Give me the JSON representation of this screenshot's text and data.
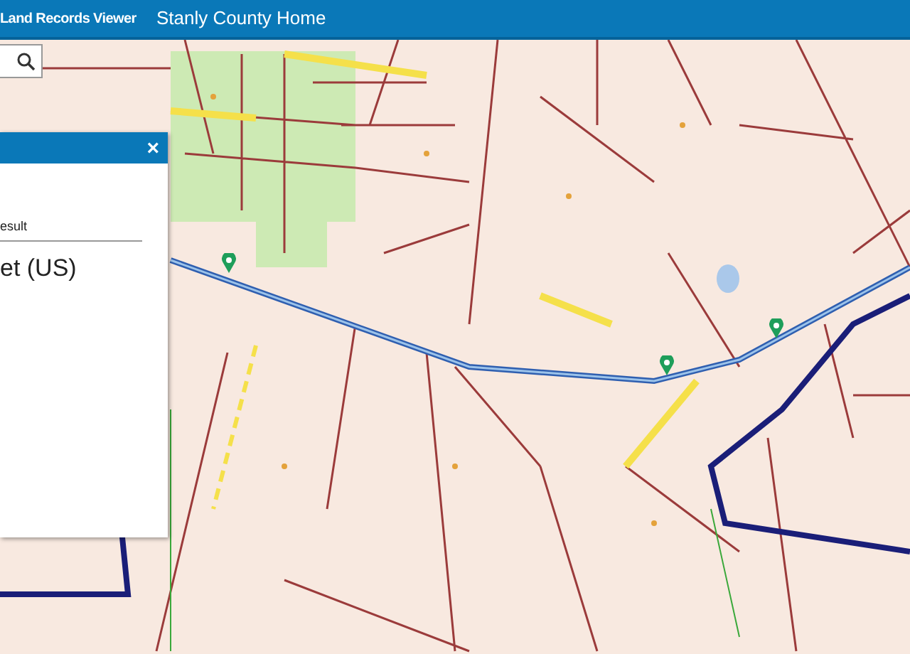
{
  "header": {
    "title": "Land Records Viewer",
    "home_link": "Stanly County Home"
  },
  "result_panel": {
    "close": "×",
    "tab": "esult",
    "heading": "et (US)"
  }
}
